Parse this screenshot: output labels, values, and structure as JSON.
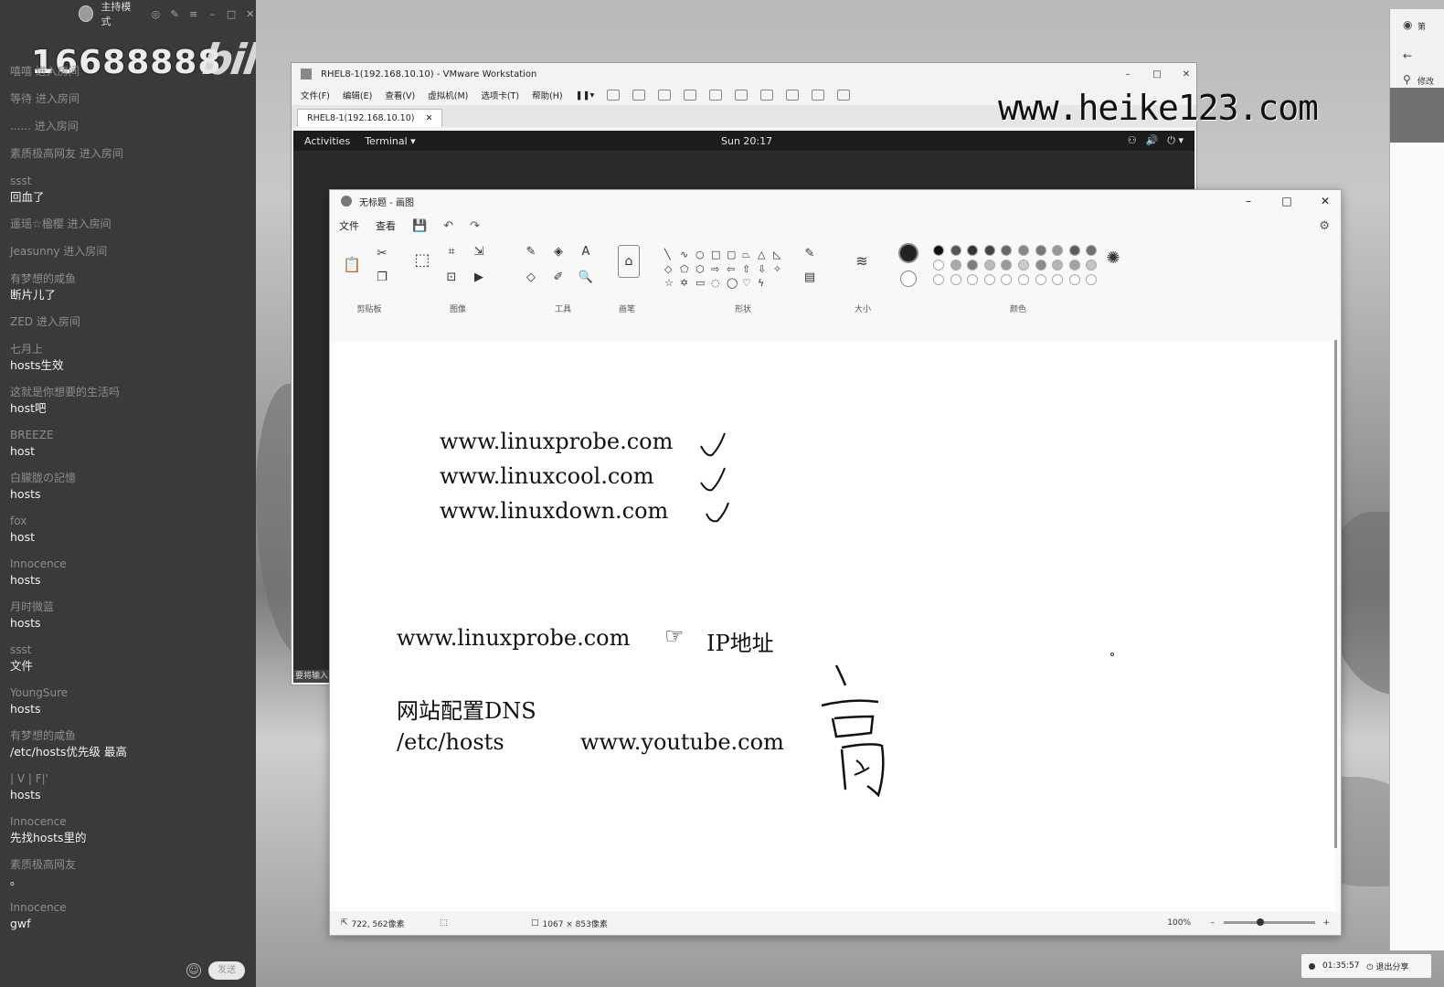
{
  "chat": {
    "mode_label": "主持模式",
    "room_id": "16688888",
    "logo": "bilibili",
    "messages": [
      {
        "type": "join",
        "user": "嘻嘻",
        "text": "进入房间"
      },
      {
        "type": "join",
        "user": "等待",
        "text": "进入房间"
      },
      {
        "type": "join",
        "user": "......",
        "text": "进入房间"
      },
      {
        "type": "join",
        "user": "素质极高网友",
        "text": "进入房间"
      },
      {
        "type": "msg",
        "user": "ssst",
        "text": "回血了"
      },
      {
        "type": "join",
        "user": "遥瑶☆楹樱",
        "text": "进入房间"
      },
      {
        "type": "join",
        "user": "Jeasunny",
        "text": "进入房间"
      },
      {
        "type": "msg",
        "user": "有梦想的咸鱼",
        "text": "断片儿了"
      },
      {
        "type": "join",
        "user": "ZED",
        "text": "进入房间"
      },
      {
        "type": "msg",
        "user": "七月上",
        "text": "hosts生效"
      },
      {
        "type": "msg",
        "user": "这就是你想要的生活吗",
        "text": "host吧"
      },
      {
        "type": "msg",
        "user": "BREEZE",
        "text": "host"
      },
      {
        "type": "msg",
        "user": "白朦胧の記憶",
        "text": "hosts"
      },
      {
        "type": "msg",
        "user": "fox",
        "text": "host"
      },
      {
        "type": "msg",
        "user": "Innocence",
        "text": "hosts"
      },
      {
        "type": "msg",
        "user": "月时微蓝",
        "text": "hosts"
      },
      {
        "type": "msg",
        "user": "ssst",
        "text": "文件"
      },
      {
        "type": "msg",
        "user": "YoungSure",
        "text": "hosts"
      },
      {
        "type": "msg",
        "user": "有梦想的咸鱼",
        "text": "/etc/hosts优先级 最高"
      },
      {
        "type": "msg",
        "user": "|  V  |  F|'",
        "text": "hosts"
      },
      {
        "type": "msg",
        "user": "Innocence",
        "text": "先找hosts里的"
      },
      {
        "type": "msg",
        "user": "素质极高网友",
        "text": "。"
      },
      {
        "type": "msg",
        "user": "Innocence",
        "text": "gwf"
      }
    ],
    "send_label": "发送"
  },
  "watermark": "www.heike123.com",
  "vmware": {
    "title": "RHEL8-1(192.168.10.10) - VMware Workstation",
    "menu": [
      "文件(F)",
      "编辑(E)",
      "查看(V)",
      "虚拟机(M)",
      "选项卡(T)",
      "帮助(H)"
    ],
    "tab_label": "RHEL8-1(192.168.10.10)",
    "guest": {
      "activities": "Activities",
      "app": "Terminal ▾",
      "clock": "Sun 20:17",
      "hint": "要将输入"
    }
  },
  "paint": {
    "title": "无标题 - 画图",
    "menu": [
      "文件",
      "查看"
    ],
    "groups": [
      "剪贴板",
      "图像",
      "工具",
      "画笔",
      "形状",
      "大小",
      "颜色"
    ],
    "colors_row1": [
      "#111111",
      "#555555",
      "#333333",
      "#444444",
      "#666666",
      "#888888",
      "#777777",
      "#999999",
      "#5a5a5a",
      "#6f6f6f"
    ],
    "colors_row2": [
      "#ffffff",
      "#aaaaaa",
      "#7d7d7d",
      "#bbbbbb",
      "#9a9a9a",
      "#cccccc",
      "#8c8c8c",
      "#b5b5b5",
      "#a3a3a3",
      "#c4c4c4"
    ],
    "colors_row3": [
      "#ffffff",
      "#ffffff",
      "#ffffff",
      "#ffffff",
      "#ffffff",
      "#ffffff",
      "#ffffff",
      "#ffffff",
      "#ffffff",
      "#ffffff"
    ],
    "canvas": {
      "line1": "www.linuxprobe.com",
      "line2": "www.linuxcool.com",
      "line3": "www.linuxdown.com",
      "line4_a": "www.linuxprobe.com",
      "line4_arrow": "☞",
      "line4_b": "IP地址",
      "line5": "网站配置DNS",
      "line6_a": "/etc/hosts",
      "line6_b": "www.youtube.com"
    },
    "status": {
      "cursor_pos": "722, 562像素",
      "canvas_size": "1067 × 853像素",
      "zoom": "100%"
    }
  },
  "right_window": {
    "label_top": "第",
    "label_edit": "修改"
  },
  "share_bar": {
    "time": "01:35:57",
    "exit_label": "退出分享"
  }
}
